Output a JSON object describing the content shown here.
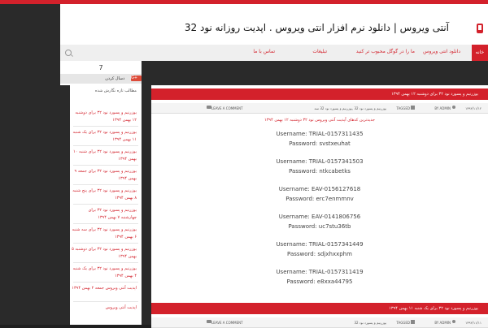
{
  "header": {
    "site_title": "آنتی ویروس | دانلود نرم افزار انتی ویروس . اپدیت روزانه نود 32"
  },
  "nav": {
    "home": "خانه",
    "items": [
      "دانلود انتی ویروس",
      "ما را در گوگل محبوب تر کنید",
      "تبلیغات",
      "تماس با ما"
    ]
  },
  "widget": {
    "value": "7",
    "button_label": "دسال کردن",
    "gplus": "G+"
  },
  "sidebar": {
    "title": "مطالب تازه نگارش شده",
    "items": [
      "یوزرنیم و پسورد نود ۳۲ برای دوشنبه ۱۲ بهمن ۱۳۹۴",
      "یوزرنیم و پسورد نود ۳۲ برای یک شنبه ۱۱ بهمن ۱۳۹۴",
      "یوزرنیم و پسورد نود ۳۲ برای شنبه ۱۰ بهمن ۱۳۹۴",
      "یوزرنیم و پسورد نود ۳۲ برای جمعه ۹ بهمن ۱۳۹۴",
      "یوزرنیم و پسورد نود ۳۲ برای پنج شنبه ۸ بهمن ۱۳۹۴",
      "یوزرنیم و پسورد نود ۳۲ برای چهارشنبه ۷ بهمن ۱۳۹۴",
      "یوزرنیم و پسورد نود ۳۲ برای سه شنبه ۶ بهمن ۱۳۹۴",
      "یوزرنیم و پسورد نود ۳۲ برای دوشنبه ۵ بهمن ۱۳۹۴",
      "یوزرنیم و پسورد نود ۳۲ برای یک شنبه ۴ بهمن ۱۳۹۴",
      "اپدیت آنتی ویروس جمعه ۲ بهمن ۱۳۹۴",
      "اپدیت آنتی ویروس"
    ]
  },
  "posts": [
    {
      "title": "یوزرنیم و پسورد نود ۳۲ برای دوشنبه ۱۲ بهمن ۱۳۹۴",
      "date": "۱۳۹۴/۱۱/۱۲",
      "author": "BY ADMIN",
      "tagged": "TAGGED",
      "tags": "یوزرنیم و پسورد نود 32 ,یوزرنیم و پسورد نود 32 سه",
      "comment": "LEAVE A COMMENT",
      "intro": "جدیدترین کدهای آپدیت آنتی ویروس نود ۳۲ دوشنبه ۱۲ بهمن ۱۳۹۴",
      "creds": [
        "Username: TRIAL-0157311435",
        "Password: svstxeuhat",
        "Username: TRIAL-0157341503",
        "Password: ntkcabetks",
        "Username: EAV-0156127618",
        "Password: erc7enmmnv",
        "Username: EAV-0141806756",
        "Password: uc7stu36tb",
        "Username: TRIAL-0157341449",
        "Password: sdjxhxxphm",
        "Username: TRIAL-0157311419",
        "Password: e8xxa44795"
      ]
    },
    {
      "title": "یوزرنیم و پسورد نود ۳۲ برای یک شنبه ۱۱ بهمن ۱۳۹۴",
      "date": "۱۳۹۴/۱۱/۱۱",
      "author": "BY ADMIN",
      "tagged": "TAGGED",
      "tags": "یوزرنیم و پسورد نود 32",
      "comment": "LEAVE A COMMENT"
    }
  ],
  "colors": {
    "accent": "#d3212b",
    "background": "#2a2a2a"
  }
}
